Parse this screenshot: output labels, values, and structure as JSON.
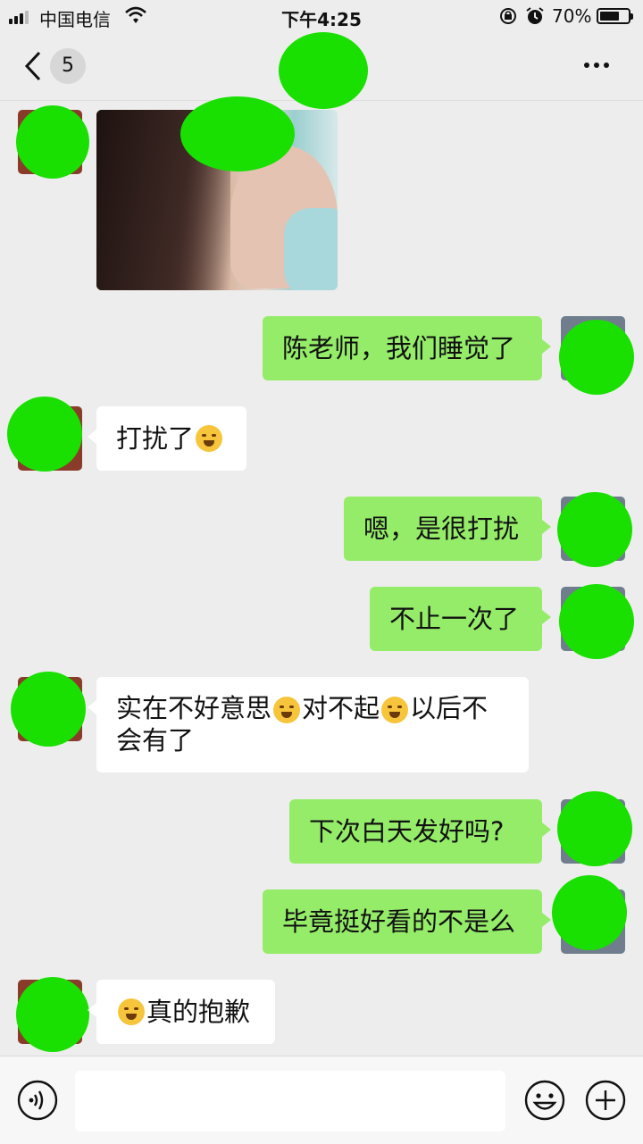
{
  "status_bar": {
    "carrier": "中国电信",
    "time": "下午4:25",
    "battery_percent": "70%",
    "battery_level": 0.7
  },
  "header": {
    "unread_count": "5"
  },
  "messages": [
    {
      "side": "incoming",
      "type": "image"
    },
    {
      "side": "outgoing",
      "text": "陈老师，我们睡觉了"
    },
    {
      "side": "incoming",
      "text": "打扰了",
      "emoji_after": "face-with-tears-of-joy"
    },
    {
      "side": "outgoing",
      "text": "嗯，是很打扰"
    },
    {
      "side": "outgoing",
      "text": "不止一次了"
    },
    {
      "side": "incoming",
      "parts": [
        "实在不好意思",
        "对不起",
        "以后不",
        "会有了"
      ],
      "emojis": [
        "anxious-face",
        "screaming-face"
      ]
    },
    {
      "side": "outgoing",
      "text": "下次白天发好吗?"
    },
    {
      "side": "outgoing",
      "text": "毕竟挺好看的不是么"
    },
    {
      "side": "incoming",
      "text": "真的抱歉",
      "emoji_before": "face-with-tears-of-joy"
    }
  ],
  "colors": {
    "chat_background": "#ededed",
    "outgoing_bubble": "#95ec69",
    "incoming_bubble": "#ffffff",
    "censor_blob": "#19e000"
  },
  "icons": {
    "back": "chevron-left-icon",
    "more": "more-dots-icon",
    "voice": "voice-icon",
    "emoji": "emoji-icon",
    "plus": "plus-icon"
  }
}
